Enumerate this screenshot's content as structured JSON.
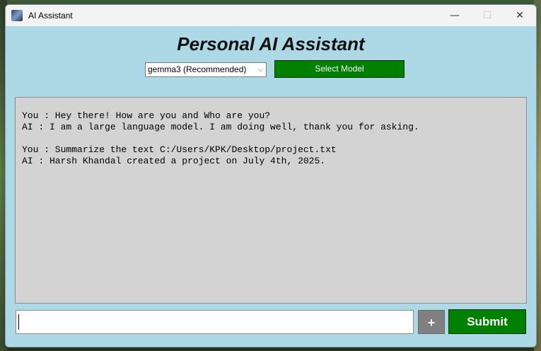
{
  "window": {
    "title": "AI Assistant",
    "controls": {
      "minimize": "—",
      "maximize": "☐",
      "close": "✕"
    }
  },
  "header": {
    "title": "Personal AI Assistant"
  },
  "model_selector": {
    "selected": "gemma3 (Recommended)",
    "chevron": "⌵",
    "button_label": "Select Model"
  },
  "chat": {
    "messages": [
      "You : Hey there! How are you and Who are you?",
      "AI : I am a large language model. I am doing well, thank you for asking.",
      "",
      "You : Summarize the text C:/Users/KPK/Desktop/project.txt",
      "AI : Harsh Khandal created a project on July 4th, 2025."
    ]
  },
  "input": {
    "value": "",
    "placeholder": ""
  },
  "buttons": {
    "plus": "+",
    "submit": "Submit"
  },
  "colors": {
    "window_bg": "#add8e6",
    "chat_bg": "#d3d3d3",
    "accent_green": "#008000",
    "plus_gray": "#808080"
  }
}
